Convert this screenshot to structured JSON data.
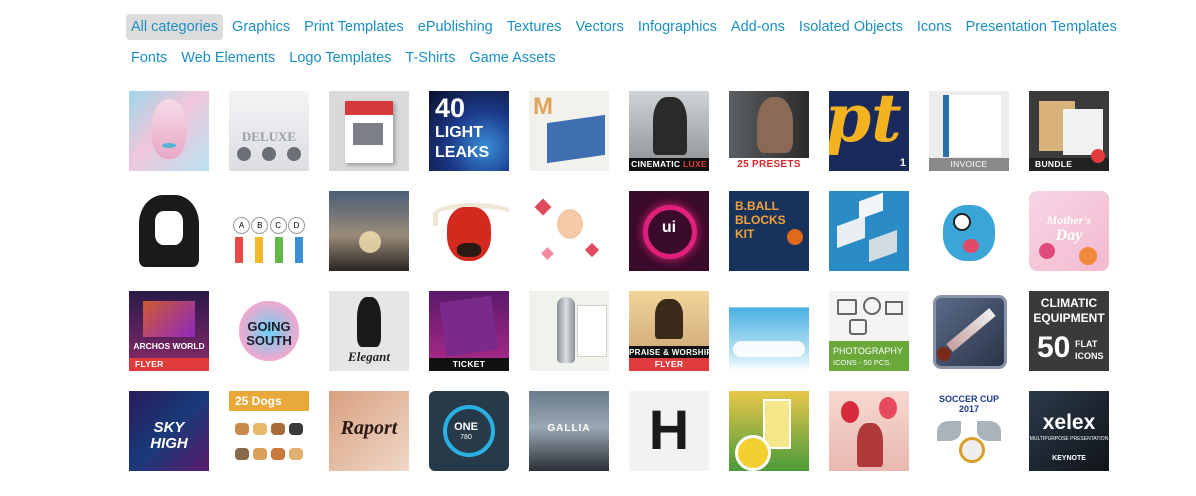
{
  "categories": {
    "row1": [
      "All categories",
      "Graphics",
      "Print Templates",
      "ePublishing",
      "Textures",
      "Vectors",
      "Infographics",
      "Add-ons",
      "Isolated Objects",
      "Icons",
      "Presentation Templates"
    ],
    "row2": [
      "Fonts",
      "Web Elements",
      "Logo Templates",
      "T-Shirts",
      "Game Assets"
    ],
    "active": "All categories"
  },
  "tiles": {
    "t1_3_leaks": {
      "num": "40",
      "line1": "LIGHT",
      "line2": "LEAKS"
    },
    "t1_6_cinematic": {
      "a": "CINEMATIC",
      "b": "LUXE"
    },
    "t1_7_presets": "25 PRESETS",
    "t1_8_pt": {
      "word": "pt",
      "num": "1"
    },
    "t1_9_invoice": "INVOICE",
    "t1_10_bundle": "BUNDLE",
    "t1_2_deluxe": "DELUXE",
    "t1_5_m": "M",
    "t2_2_abcd": [
      "A",
      "B",
      "C",
      "D"
    ],
    "t2_6_ui": "ui",
    "t2_7_bball": {
      "l1": "B.BALL",
      "l2": "BLOCKS",
      "l3": "KIT"
    },
    "t2_10_mothers": {
      "l1": "Mother's",
      "l2": "Day"
    },
    "t3_1_flyer": {
      "title": "ARCHOS WORLD",
      "cap": "FLYER"
    },
    "t3_2_going": {
      "l1": "GOING",
      "l2": "SOUTH"
    },
    "t3_3_elegant": "Elegant",
    "t3_4_ticket": "TICKET",
    "t3_6_praise": {
      "cap1": "PRAISE & WORSHIP",
      "cap2": "FLYER"
    },
    "t3_8_photo": {
      "l1": "PHOTOGRAPHY",
      "l2": "ICONS - 50 PCS."
    },
    "t3_10_climatic": {
      "l1": "CLIMATIC",
      "l2": "EQUIPMENT",
      "num": "50",
      "flat": "FLAT",
      "icons": "ICONS"
    },
    "t4_1_sky": {
      "l1": "SKY",
      "l2": "HIGH"
    },
    "t4_2_dogs": "25 Dogs",
    "t4_3_raport": "Raport",
    "t4_4_one": {
      "word": "ONE",
      "num": "780"
    },
    "t4_5_gallia": "GALLIA",
    "t4_6_h": "H",
    "t4_9_soccer": {
      "l1": "SOCCER CUP",
      "l2": "2017"
    },
    "t4_10_xelex": {
      "word": "xelex",
      "sub": "MULTIPURPOSE PRESENTATION",
      "kn": "KEYNOTE"
    }
  },
  "colors": {
    "link": "#1a8fc4",
    "active_bg": "#dcdcdc"
  }
}
